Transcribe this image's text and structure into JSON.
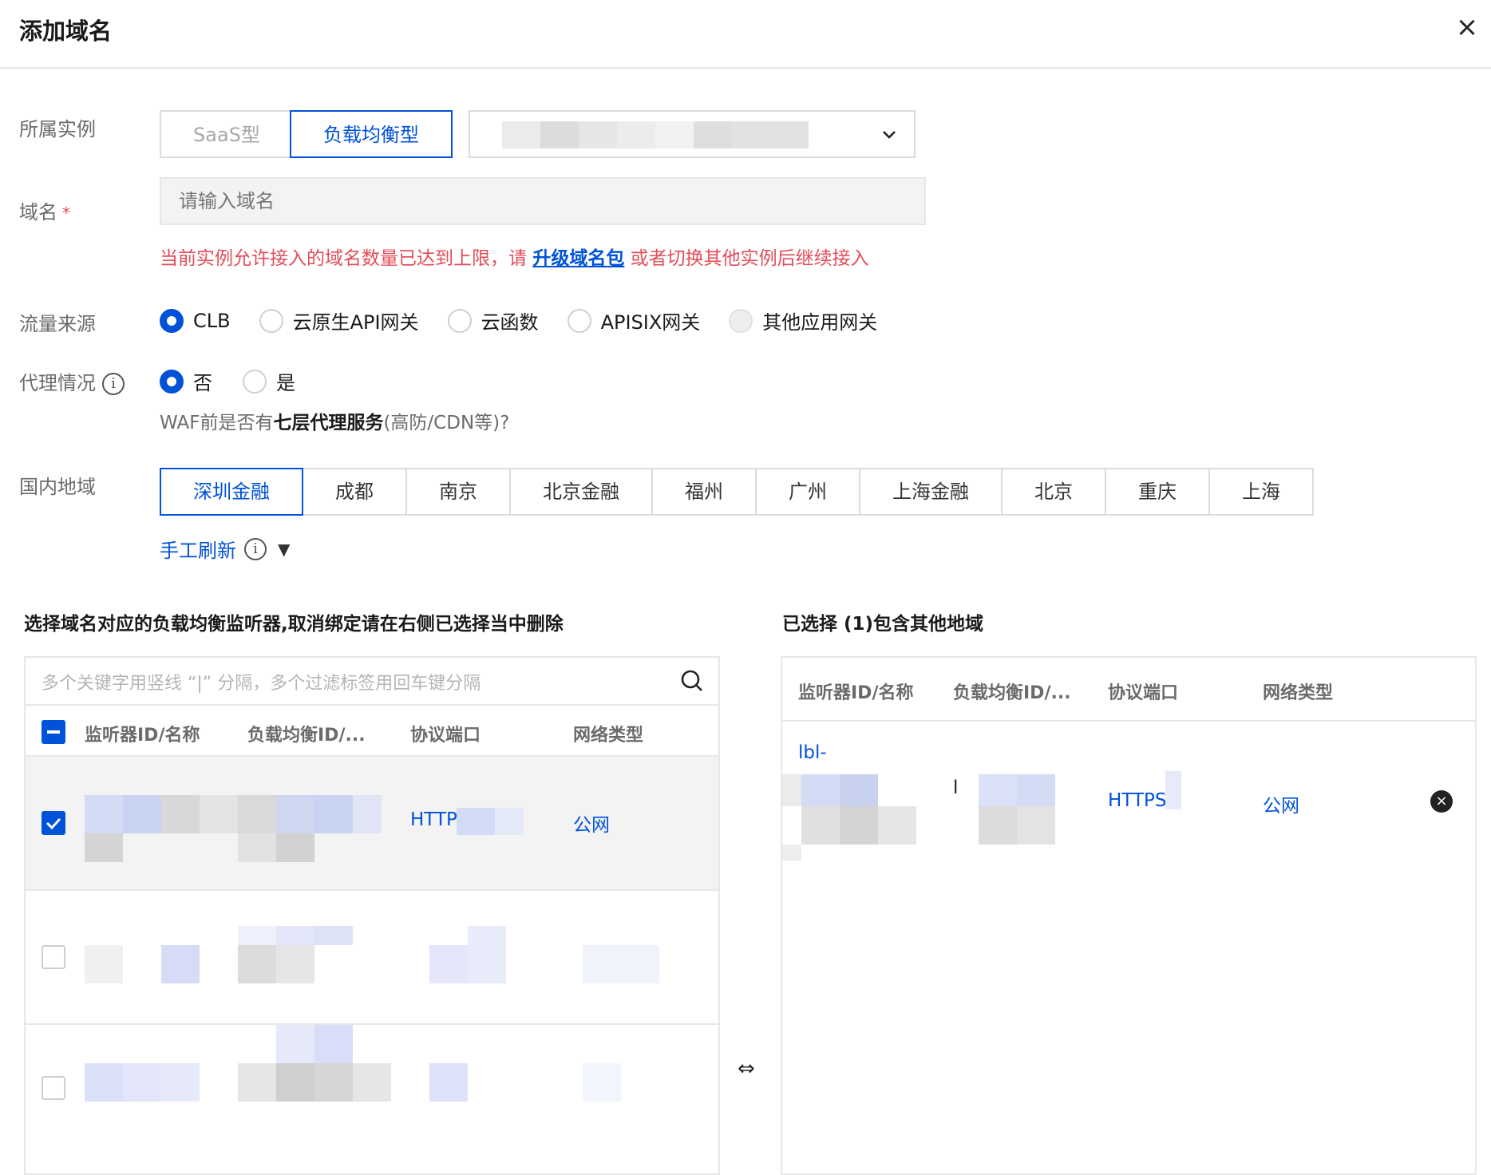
{
  "dialog": {
    "title": "添加域名",
    "close_label": "×"
  },
  "instance": {
    "label": "所属实例",
    "types": [
      "SaaS型",
      "负载均衡型"
    ],
    "selected_type": "负载均衡型"
  },
  "domain": {
    "label": "域名",
    "required_mark": "*",
    "placeholder": "请输入域名",
    "warning_prefix": "当前实例允许接入的域名数量已达到上限，请 ",
    "warning_link": "升级域名包",
    "warning_suffix": " 或者切换其他实例后继续接入"
  },
  "traffic_source": {
    "label": "流量来源",
    "options": [
      "CLB",
      "云原生API网关",
      "云函数",
      "APISIX网关",
      "其他应用网关"
    ],
    "selected": "CLB"
  },
  "proxy": {
    "label": "代理情况",
    "options": [
      "否",
      "是"
    ],
    "selected": "否",
    "hint_prefix": "WAF前是否有",
    "hint_bold": "七层代理服务",
    "hint_suffix": "(高防/CDN等)?"
  },
  "region": {
    "label": "国内地域",
    "options": [
      "深圳金融",
      "成都",
      "南京",
      "北京金融",
      "福州",
      "广州",
      "上海金融",
      "北京",
      "重庆",
      "上海"
    ],
    "selected": "深圳金融",
    "refresh_label": "手工刷新"
  },
  "left_panel": {
    "title": "选择域名对应的负载均衡监听器,取消绑定请在右侧已选择当中删除",
    "search_placeholder": "多个关键字用竖线 “|” 分隔，多个过滤标签用回车键分隔",
    "columns": [
      "监听器ID/名称",
      "负载均衡ID/...",
      "协议端口",
      "网络类型"
    ],
    "rows": [
      {
        "checked": true,
        "protocol": "HTTP",
        "network": "公网"
      },
      {
        "checked": false,
        "protocol": "",
        "network": ""
      },
      {
        "checked": false,
        "protocol": "",
        "network": ""
      }
    ]
  },
  "right_panel": {
    "title": "已选择 (1)包含其他地域",
    "columns": [
      "监听器ID/名称",
      "负载均衡ID/...",
      "协议端口",
      "网络类型"
    ],
    "rows": [
      {
        "listener_prefix": "lbl-",
        "lb_prefix": "l",
        "protocol": "HTTPS",
        "network": "公网"
      }
    ]
  },
  "transfer_icon": "⇔"
}
